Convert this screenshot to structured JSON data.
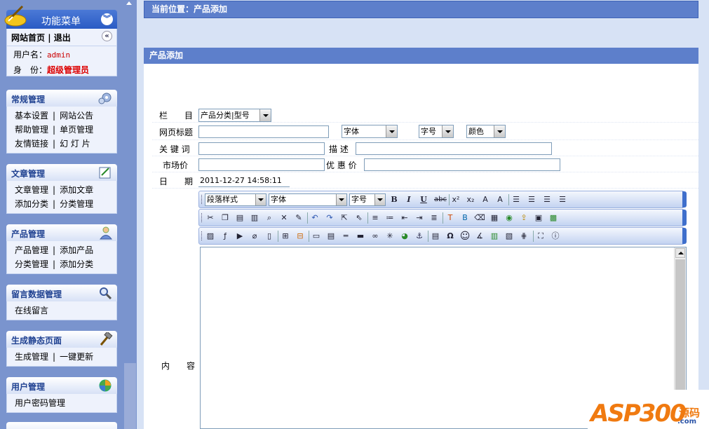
{
  "menu": {
    "title": "功能菜单",
    "home": "网站首页",
    "sep": "|",
    "logout": "退出",
    "user_label": "用户名：",
    "user_value": "admin",
    "role_label": "身　份：",
    "role_value": "超级管理员"
  },
  "groups": [
    {
      "title": "常规管理",
      "lines": [
        [
          "基本设置",
          "网站公告"
        ],
        [
          "帮助管理",
          "单页管理"
        ],
        [
          "友情链接",
          "幻 灯 片"
        ]
      ]
    },
    {
      "title": "文章管理",
      "lines": [
        [
          "文章管理",
          "添加文章"
        ],
        [
          "添加分类",
          "分类管理"
        ]
      ]
    },
    {
      "title": "产品管理",
      "lines": [
        [
          "产品管理",
          "添加产品"
        ],
        [
          "分类管理",
          "添加分类"
        ]
      ]
    },
    {
      "title": "留言数据管理",
      "lines": [
        [
          "在线留言"
        ]
      ]
    },
    {
      "title": "生成静态页面",
      "lines": [
        [
          "生成管理",
          "一键更新"
        ]
      ]
    },
    {
      "title": "用户管理",
      "lines": [
        [
          "用户密码管理"
        ]
      ]
    }
  ],
  "breadcrumb": "当前位置：产品添加",
  "panel_title": "产品添加",
  "form": {
    "column_label": "栏　　目",
    "column_value": "产品分类|型号",
    "page_title_label": "网页标题",
    "page_title_value": "",
    "font_select": "字体",
    "size_select": "字号",
    "color_select": "颜色",
    "keywords_label": "关 键 词",
    "keywords_value": "",
    "desc_label": "描 述",
    "desc_value": "",
    "market_price_label": "市场价",
    "market_price_value": "",
    "discount_price_label": "优 惠 价",
    "discount_price_value": "",
    "date_label": "日　　期",
    "date_value": "2011-12-27 14:58:11",
    "content_label": "内　　容"
  },
  "editor": {
    "paragraph_select": "段落样式",
    "font_select": "字体",
    "size_select": "字号",
    "bold": "B",
    "italic": "I",
    "underline": "U",
    "strike": "abc",
    "sup": "x²",
    "sub": "x₂",
    "omega": "Ω",
    "smiley": "☺"
  },
  "watermark": {
    "brand": "ASP300",
    "cn": "源码",
    "com": ".com"
  },
  "colors": {
    "menu_bg": "#7a94ce",
    "header_blue": "#5d7fcb",
    "main_bg": "#d7e2f5",
    "role_red": "#dd0000"
  }
}
